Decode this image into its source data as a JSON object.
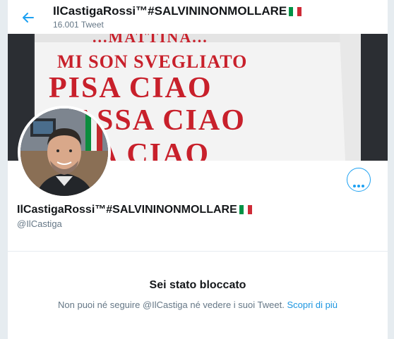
{
  "header": {
    "back_icon": "arrow-left-icon",
    "title": "IlCastigaRossi™#SALVININONMOLLARE",
    "tweet_count": "16.001 Tweet"
  },
  "flag_colors": [
    "#009246",
    "#ffffff",
    "#ce2b37"
  ],
  "accent_color": "#1da1f2",
  "banner": {
    "shirt_text": [
      "...MATTINA...",
      "MI SON SVEGLIATO",
      "PISA CIAO",
      "MASSA CIAO",
      "...NA CIAO"
    ]
  },
  "profile": {
    "display_name": "IlCastigaRossi™#SALVININONMOLLARE",
    "handle": "@IlCastiga",
    "more_icon": "more-horizontal-icon"
  },
  "blocked": {
    "title": "Sei stato bloccato",
    "message": "Non puoi né seguire @IlCastiga né vedere i suoi Tweet.",
    "link": "Scopri di più"
  }
}
